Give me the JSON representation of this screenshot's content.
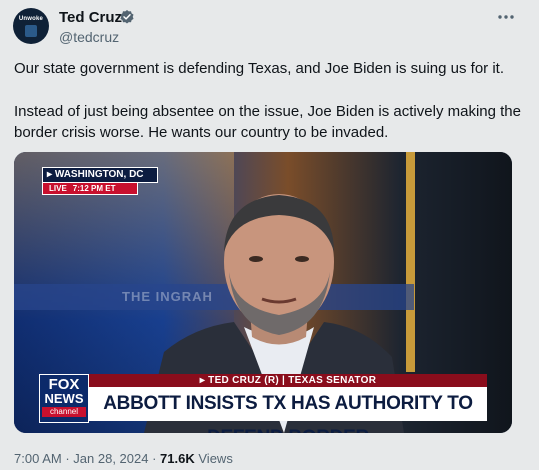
{
  "author": {
    "name": "Ted Cruz",
    "handle": "@tedcruz",
    "avatar_text": "Unwoke",
    "verified_color": "#536471"
  },
  "tweet": {
    "paragraph1": "Our state government is defending Texas, and Joe Biden is suing us for it.",
    "paragraph2": "Instead of just being absentee on the issue, Joe Biden is actively making the border crisis worse. He wants our country to be invaded."
  },
  "media": {
    "location": "WASHINGTON, DC",
    "live_label": "LIVE",
    "live_time": "7:12 PM ET",
    "background_show": "THE INGRAH",
    "network_logo": {
      "line1": "FOX",
      "line2": "NEWS",
      "line3": "channel"
    },
    "name_banner": "TED CRUZ (R) | TEXAS SENATOR",
    "headline": "ABBOTT INSISTS TX HAS AUTHORITY TO DEFEND BORDER"
  },
  "footer": {
    "time": "7:00 AM",
    "date": "Jan 28, 2024",
    "views_count": "71.6K",
    "views_label": "Views"
  },
  "icons": {
    "more": "more-icon",
    "verified": "verified-badge-icon"
  }
}
